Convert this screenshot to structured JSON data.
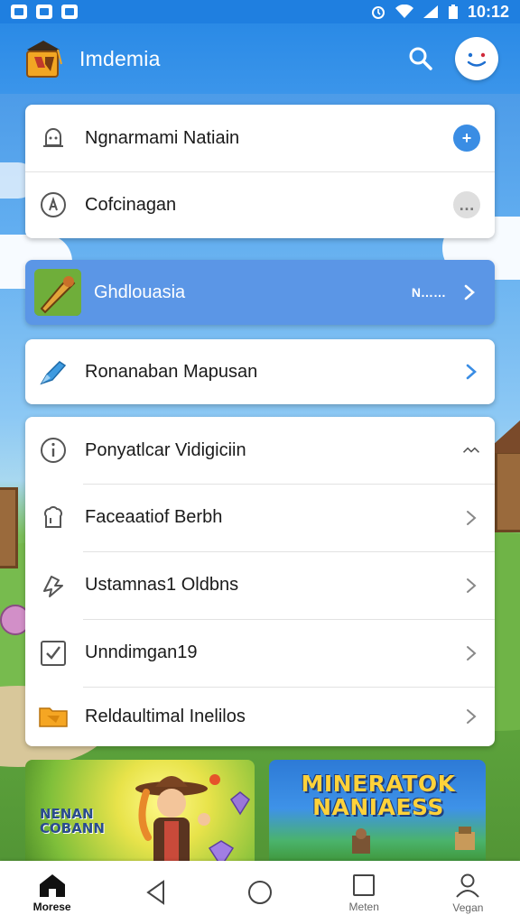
{
  "status_bar": {
    "time": "10:12"
  },
  "app_bar": {
    "title": "Imdemia"
  },
  "top_card": {
    "items": [
      {
        "label": "Ngnarmami Natiain",
        "action": "+"
      },
      {
        "label": "Cofcinagan",
        "action": "…"
      }
    ]
  },
  "highlight_item": {
    "label": "Ghdlouasia",
    "meta": "N……"
  },
  "single_item": {
    "label": "Ronanaban Mapusan"
  },
  "list_card": {
    "items": [
      {
        "label": "Ponyatlcar Vidigiciin"
      },
      {
        "label": "Faceaatiof Berbh"
      },
      {
        "label": "Ustamnas1 Oldbns"
      },
      {
        "label": "Unndimgan19"
      },
      {
        "label": "Reldaultimal Inelilos"
      }
    ]
  },
  "promo_tiles": [
    {
      "text_line1": "NENAN",
      "text_line2": "COBANN"
    },
    {
      "text_line1": "MINERATOK",
      "text_line2": "NANIAESS"
    }
  ],
  "bottom_nav": {
    "items": [
      {
        "label": "Morese"
      },
      {
        "label": ""
      },
      {
        "label": ""
      },
      {
        "label": "Meten"
      },
      {
        "label": "Vegan"
      }
    ]
  },
  "colors": {
    "app_bar": "#2a8ae6",
    "accent": "#3a8de4",
    "highlight": "#5b96e6"
  }
}
